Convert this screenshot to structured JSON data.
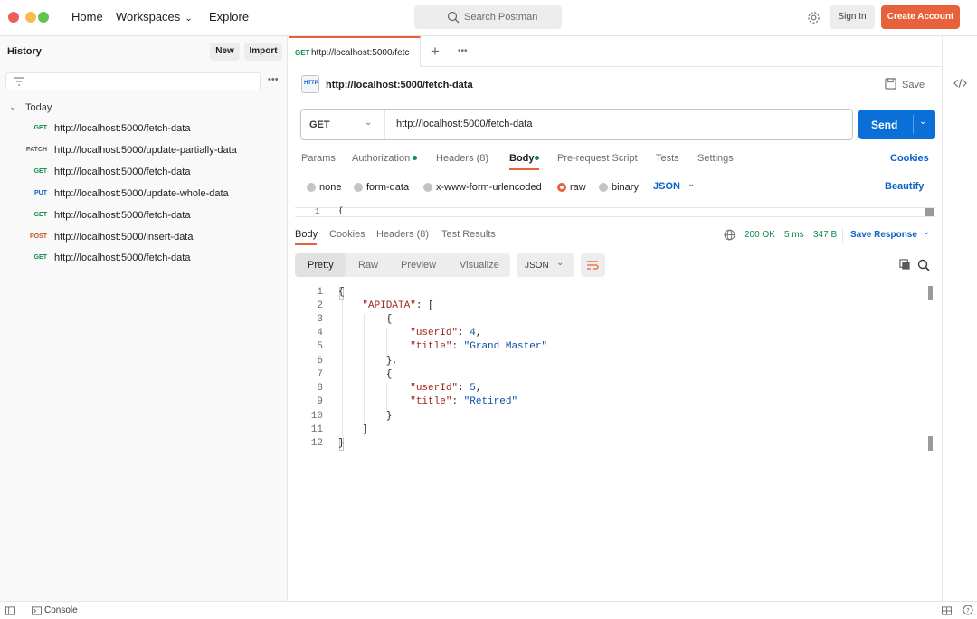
{
  "topbar": {
    "home": "Home",
    "workspaces": "Workspaces",
    "explore": "Explore",
    "search_placeholder": "Search Postman",
    "sign_in": "Sign In",
    "create_account": "Create Account"
  },
  "sidebar": {
    "title": "History",
    "new": "New",
    "import": "Import",
    "group": "Today",
    "items": [
      {
        "method": "GET",
        "url": "http://localhost:5000/fetch-data",
        "color": "#0f8a4a"
      },
      {
        "method": "PATCH",
        "url": "http://localhost:5000/update-partially-data",
        "color": "#5a5a5a"
      },
      {
        "method": "GET",
        "url": "http://localhost:5000/fetch-data",
        "color": "#0f8a4a"
      },
      {
        "method": "PUT",
        "url": "http://localhost:5000/update-whole-data",
        "color": "#0b62c4"
      },
      {
        "method": "GET",
        "url": "http://localhost:5000/fetch-data",
        "color": "#0f8a4a"
      },
      {
        "method": "POST",
        "url": "http://localhost:5000/insert-data",
        "color": "#c9511d"
      },
      {
        "method": "GET",
        "url": "http://localhost:5000/fetch-data",
        "color": "#0f8a4a"
      }
    ]
  },
  "tab": {
    "method": "GET",
    "title": "http://localhost:5000/fetc"
  },
  "request": {
    "name": "http://localhost:5000/fetch-data",
    "save": "Save",
    "method": "GET",
    "url": "http://localhost:5000/fetch-data",
    "send": "Send",
    "tabs": [
      "Params",
      "Authorization",
      "Headers (8)",
      "Body",
      "Pre-request Script",
      "Tests",
      "Settings"
    ],
    "cookies": "Cookies",
    "body_types": [
      "none",
      "form-data",
      "x-www-form-urlencoded",
      "raw",
      "binary"
    ],
    "body_format": "JSON",
    "beautify": "Beautify",
    "body_line": "1",
    "body_first_char": "{"
  },
  "response": {
    "tabs": [
      "Body",
      "Cookies",
      "Headers (8)",
      "Test Results"
    ],
    "status": "200 OK",
    "time": "5 ms",
    "size": "347 B",
    "save_response": "Save Response",
    "views": [
      "Pretty",
      "Raw",
      "Preview",
      "Visualize"
    ],
    "format": "JSON",
    "lines": [
      "1",
      "2",
      "3",
      "4",
      "5",
      "6",
      "7",
      "8",
      "9",
      "10",
      "11",
      "12"
    ]
  },
  "statusbar": {
    "console": "Console"
  },
  "colors": {
    "accent": "#e8613a",
    "send": "#0b6fd8",
    "get": "#0f8a4a"
  }
}
